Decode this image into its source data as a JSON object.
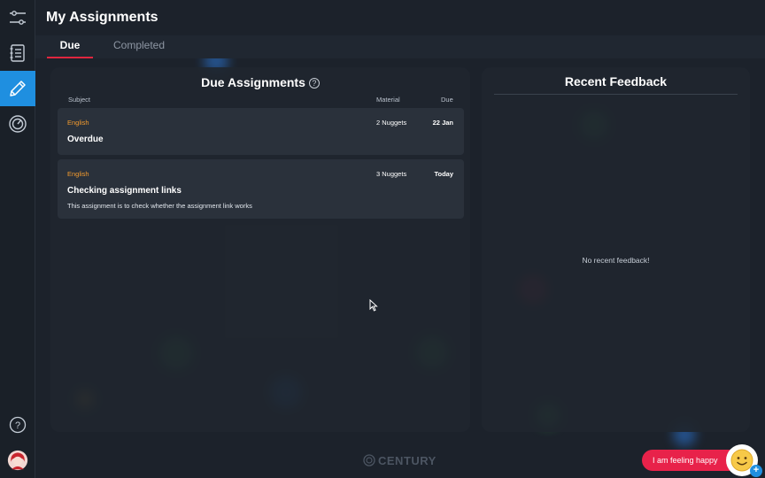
{
  "header": {
    "title": "My Assignments"
  },
  "tabs": [
    {
      "label": "Due",
      "active": true
    },
    {
      "label": "Completed",
      "active": false
    }
  ],
  "sidebar": {
    "items": [
      {
        "icon": "sliders-icon",
        "active": false
      },
      {
        "icon": "notebook-icon",
        "active": false
      },
      {
        "icon": "pencil-icon",
        "active": true
      },
      {
        "icon": "gauge-icon",
        "active": false
      }
    ],
    "help_icon": "question-circle-icon",
    "avatar_icon": "avatar"
  },
  "due_panel": {
    "title": "Due Assignments",
    "columns": {
      "subject": "Subject",
      "material": "Material",
      "due": "Due"
    },
    "assignments": [
      {
        "subject": "English",
        "material": "2 Nuggets",
        "due": "22 Jan",
        "name": "Overdue",
        "description": ""
      },
      {
        "subject": "English",
        "material": "3 Nuggets",
        "due": "Today",
        "name": "Checking assignment links",
        "description": "This assignment is to check whether the assignment link works"
      }
    ]
  },
  "feedback_panel": {
    "title": "Recent Feedback",
    "empty_message": "No recent feedback!"
  },
  "footer": {
    "brand": "CENTURY",
    "mood_label": "I am feeling happy"
  },
  "colors": {
    "accent_blue": "#1f8fe0",
    "accent_red": "#e0263f",
    "subject_orange": "#f29a2e",
    "background": "#1c222b"
  }
}
